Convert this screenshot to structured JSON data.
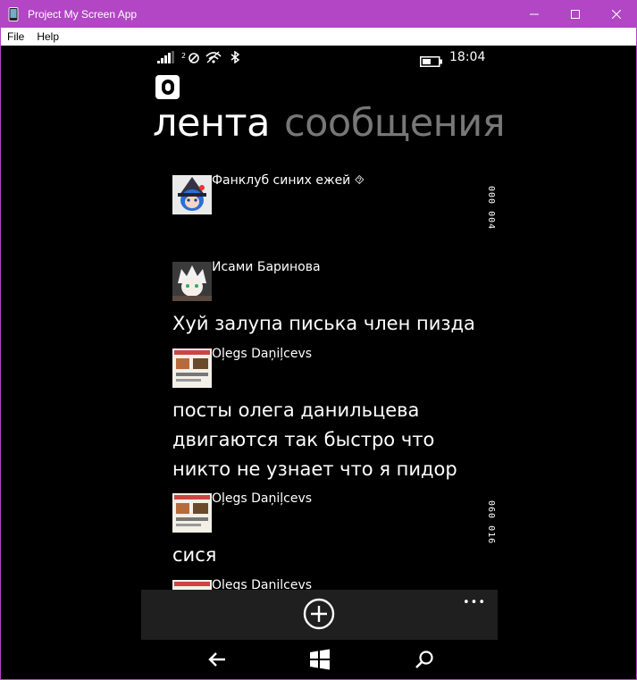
{
  "window": {
    "title": "Project My Screen App",
    "menu": [
      {
        "label": "File"
      },
      {
        "label": "Help"
      }
    ],
    "titlebar_color": "#b246c4"
  },
  "status": {
    "time": "18:04"
  },
  "pivot": {
    "active": "лента",
    "inactive": "сообщения"
  },
  "feed": {
    "items": [
      {
        "author": "Фанклуб синих ежей ⯑",
        "text": "",
        "counters": "000 004"
      },
      {
        "author": "Исами Баринова",
        "text": "Хуй залупа писька член пизда"
      },
      {
        "author": "Oļegs Daņiļcevs",
        "text": "посты олега данильцева\nдвигаются так быстро что\nникто не узнает что я пидор"
      },
      {
        "author": "Oļegs Daņiļcevs",
        "text": "сися",
        "counters": "060 016"
      },
      {
        "author": "Oļegs Daņiļcevs",
        "text": ""
      }
    ]
  },
  "appbar": {
    "more": "•••"
  },
  "icons": {
    "app": "phone-icon",
    "minimize": "minimize-icon",
    "maximize": "maximize-icon",
    "close": "close-icon",
    "signal": "signal-icon",
    "roaming": "roaming-icon",
    "wifi": "wifi-icon",
    "bluetooth": "bluetooth-icon",
    "battery": "battery-icon",
    "add": "add-icon",
    "back": "back-icon",
    "start": "windows-icon",
    "search": "search-icon"
  }
}
